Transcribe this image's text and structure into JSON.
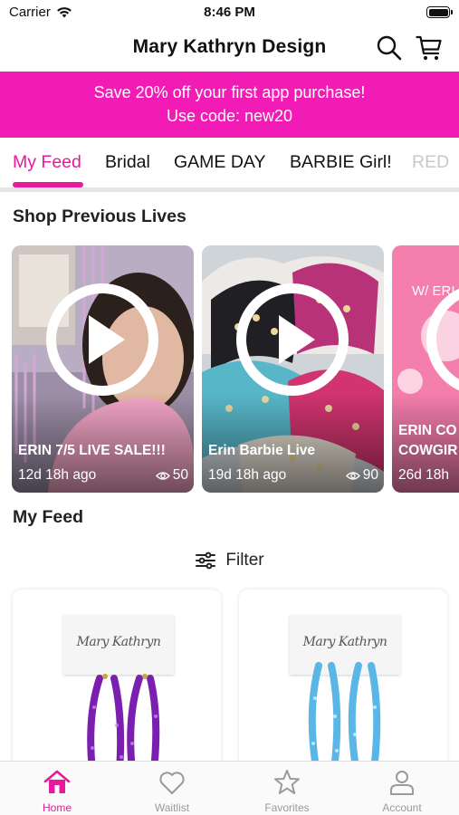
{
  "status_bar": {
    "carrier": "Carrier",
    "time": "8:46 PM"
  },
  "header": {
    "title": "Mary Kathryn Design",
    "icons": [
      "search-icon",
      "cart-icon"
    ]
  },
  "promo": {
    "line1": "Save 20% off your first app purchase!",
    "line2": "Use code: new20",
    "color": "#f31bb6"
  },
  "tabs": [
    {
      "label": "My Feed",
      "active": true
    },
    {
      "label": "Bridal"
    },
    {
      "label": "GAME DAY"
    },
    {
      "label": "BARBIE Girl!"
    },
    {
      "label": "RED"
    }
  ],
  "accent_color": "#e8189f",
  "previous_lives": {
    "heading": "Shop Previous Lives",
    "cards": [
      {
        "title": "ERIN 7/5 LIVE SALE!!!",
        "ago": "12d 18h ago",
        "views": "50"
      },
      {
        "title": "Erin Barbie Live",
        "ago": "19d 18h ago",
        "views": "90"
      },
      {
        "title": "ERIN CO",
        "title_line2": "COWGIR",
        "ago": "26d 18h",
        "banner_text": "W/ ERI"
      }
    ]
  },
  "feed": {
    "heading": "My Feed",
    "filter_label": "Filter",
    "products": [
      {
        "tag_text": "Mary Kathryn",
        "color": "purple"
      },
      {
        "tag_text": "Mary Kathryn",
        "color": "light blue"
      }
    ]
  },
  "bottom_nav": [
    {
      "label": "Home",
      "icon": "home-icon",
      "active": true
    },
    {
      "label": "Waitlist",
      "icon": "heart-icon"
    },
    {
      "label": "Favorites",
      "icon": "star-icon"
    },
    {
      "label": "Account",
      "icon": "person-icon"
    }
  ]
}
